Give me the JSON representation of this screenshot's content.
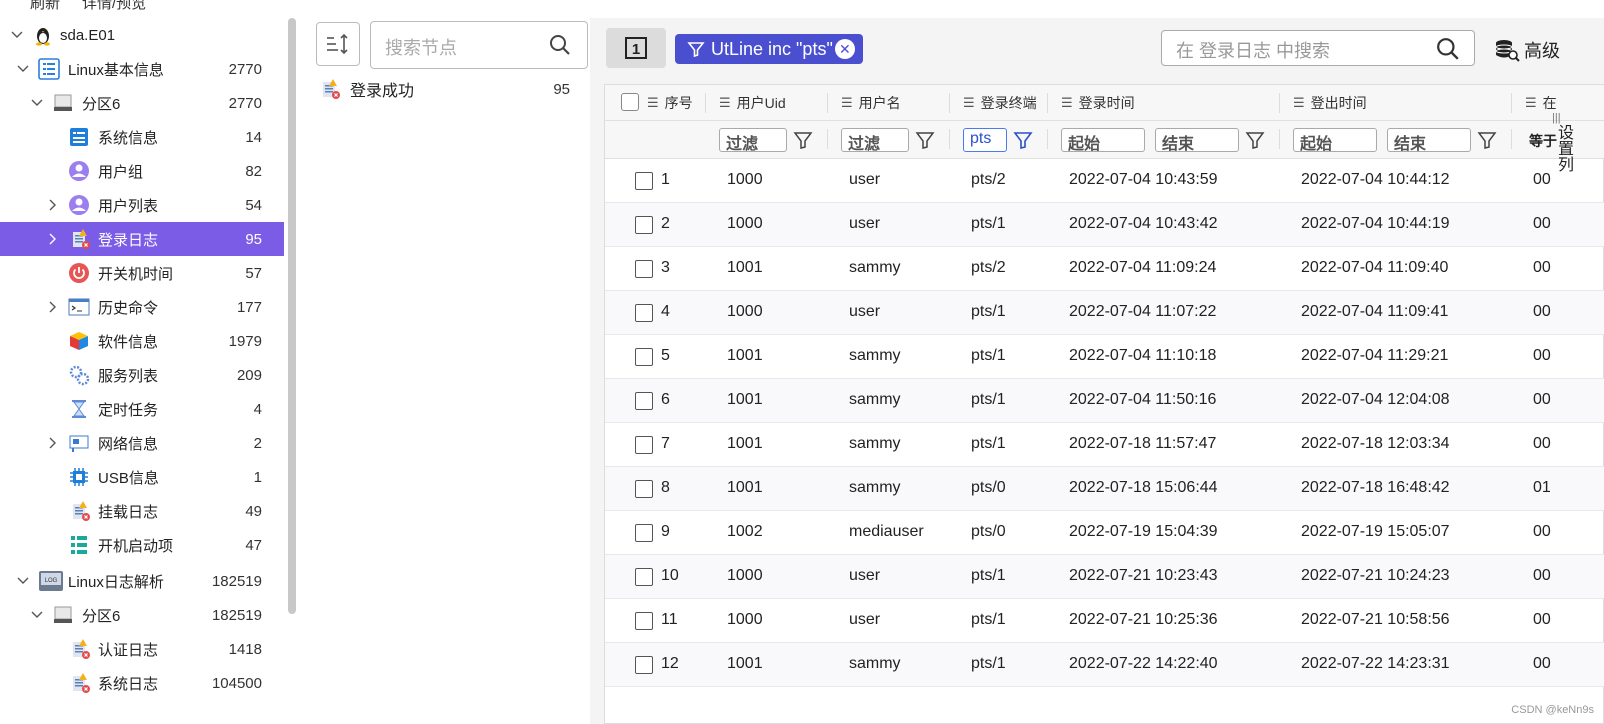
{
  "top_menu": {
    "refresh": "刷新",
    "details": "详情/预览"
  },
  "tree": {
    "root": {
      "label": "sda.E01"
    },
    "items": [
      {
        "label": "Linux基本信息",
        "count": "2770"
      },
      {
        "label": "分区6",
        "count": "2770"
      },
      {
        "label": "系统信息",
        "count": "14"
      },
      {
        "label": "用户组",
        "count": "82"
      },
      {
        "label": "用户列表",
        "count": "54"
      },
      {
        "label": "登录日志",
        "count": "95"
      },
      {
        "label": "开关机时间",
        "count": "57"
      },
      {
        "label": "历史命令",
        "count": "177"
      },
      {
        "label": "软件信息",
        "count": "1979"
      },
      {
        "label": "服务列表",
        "count": "209"
      },
      {
        "label": "定时任务",
        "count": "4"
      },
      {
        "label": "网络信息",
        "count": "2"
      },
      {
        "label": "USB信息",
        "count": "1"
      },
      {
        "label": "挂载日志",
        "count": "49"
      },
      {
        "label": "开机启动项",
        "count": "47"
      },
      {
        "label": "Linux日志解析",
        "count": "182519"
      },
      {
        "label": "分区6",
        "count": "182519"
      },
      {
        "label": "认证日志",
        "count": "1418"
      },
      {
        "label": "系统日志",
        "count": "104500"
      }
    ]
  },
  "middle": {
    "search_placeholder": "搜索节点",
    "item": {
      "label": "登录成功",
      "count": "95"
    }
  },
  "toolbar": {
    "page_icon": "1",
    "filter_chip": "UtLine inc \"pts\"",
    "search_placeholder": "在 登录日志 中搜索",
    "advanced": "高级"
  },
  "table": {
    "headers": [
      "序号",
      "用户Uid",
      "用户名",
      "登录终端",
      "登录时间",
      "登出时间",
      "在"
    ],
    "filters": {
      "uid": "过滤",
      "name": "过滤",
      "terminal": "pts",
      "login_start": "起始",
      "login_end": "结束",
      "logout_start": "起始",
      "logout_end": "结束",
      "extra": "等于"
    },
    "rows": [
      [
        "1",
        "1000",
        "user",
        "pts/2",
        "2022-07-04 10:43:59",
        "2022-07-04 10:44:12",
        "00"
      ],
      [
        "2",
        "1000",
        "user",
        "pts/1",
        "2022-07-04 10:43:42",
        "2022-07-04 10:44:19",
        "00"
      ],
      [
        "3",
        "1001",
        "sammy",
        "pts/2",
        "2022-07-04 11:09:24",
        "2022-07-04 11:09:40",
        "00"
      ],
      [
        "4",
        "1000",
        "user",
        "pts/1",
        "2022-07-04 11:07:22",
        "2022-07-04 11:09:41",
        "00"
      ],
      [
        "5",
        "1001",
        "sammy",
        "pts/1",
        "2022-07-04 11:10:18",
        "2022-07-04 11:29:21",
        "00"
      ],
      [
        "6",
        "1001",
        "sammy",
        "pts/1",
        "2022-07-04 11:50:16",
        "2022-07-04 12:04:08",
        "00"
      ],
      [
        "7",
        "1001",
        "sammy",
        "pts/1",
        "2022-07-18 11:57:47",
        "2022-07-18 12:03:34",
        "00"
      ],
      [
        "8",
        "1001",
        "sammy",
        "pts/0",
        "2022-07-18 15:06:44",
        "2022-07-18 16:48:42",
        "01"
      ],
      [
        "9",
        "1002",
        "mediauser",
        "pts/0",
        "2022-07-19 15:04:39",
        "2022-07-19 15:05:07",
        "00"
      ],
      [
        "10",
        "1000",
        "user",
        "pts/1",
        "2022-07-21 10:23:43",
        "2022-07-21 10:24:23",
        "00"
      ],
      [
        "11",
        "1000",
        "user",
        "pts/1",
        "2022-07-21 10:25:36",
        "2022-07-21 10:58:56",
        "00"
      ],
      [
        "12",
        "1001",
        "sammy",
        "pts/1",
        "2022-07-22 14:22:40",
        "2022-07-22 14:23:31",
        "00"
      ]
    ]
  },
  "side_settings": "设置列",
  "watermark": "CSDN @keNn9s",
  "colors": {
    "selected": "#7b5ce6",
    "chip": "#4a4fd0"
  }
}
